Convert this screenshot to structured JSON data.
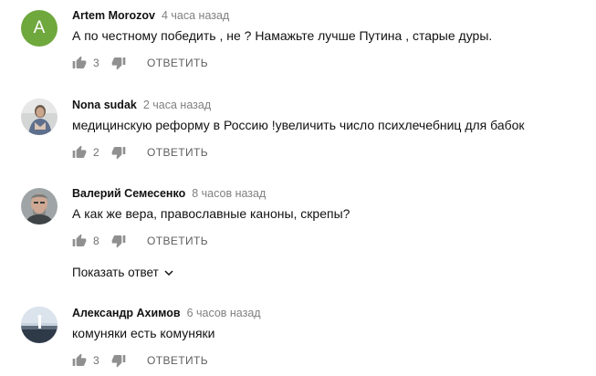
{
  "comments": [
    {
      "author": "Artem Morozov",
      "time": "4 часа назад",
      "avatar_letter": "A",
      "text": "А по честному победить , не ? Намажьте  лучше Путина , старые дуры.",
      "likes": "3",
      "reply_label": "ОТВЕТИТЬ"
    },
    {
      "author": "Nona sudak",
      "time": "2 часа назад",
      "text": "медицинскую реформу в Россию !увеличить число психлечебниц для бабок",
      "likes": "2",
      "reply_label": "ОТВЕТИТЬ"
    },
    {
      "author": "Валерий Семесенко",
      "time": "8 часов назад",
      "text": "А как же вера, православные каноны, скрепы?",
      "likes": "8",
      "reply_label": "ОТВЕТИТЬ",
      "show_replies_label": "Показать ответ"
    },
    {
      "author": "Александр Ахимов",
      "time": "6 часов назад",
      "text": "комуняки есть комуняки",
      "likes": "3",
      "reply_label": "ОТВЕТИТЬ"
    }
  ],
  "colors": {
    "avatar_letter_bg": "#6fa83d",
    "icon": "#909090",
    "meta": "#808080"
  },
  "icons": {
    "like": "thumb-up-icon",
    "dislike": "thumb-down-icon",
    "expand": "chevron-down-icon"
  }
}
